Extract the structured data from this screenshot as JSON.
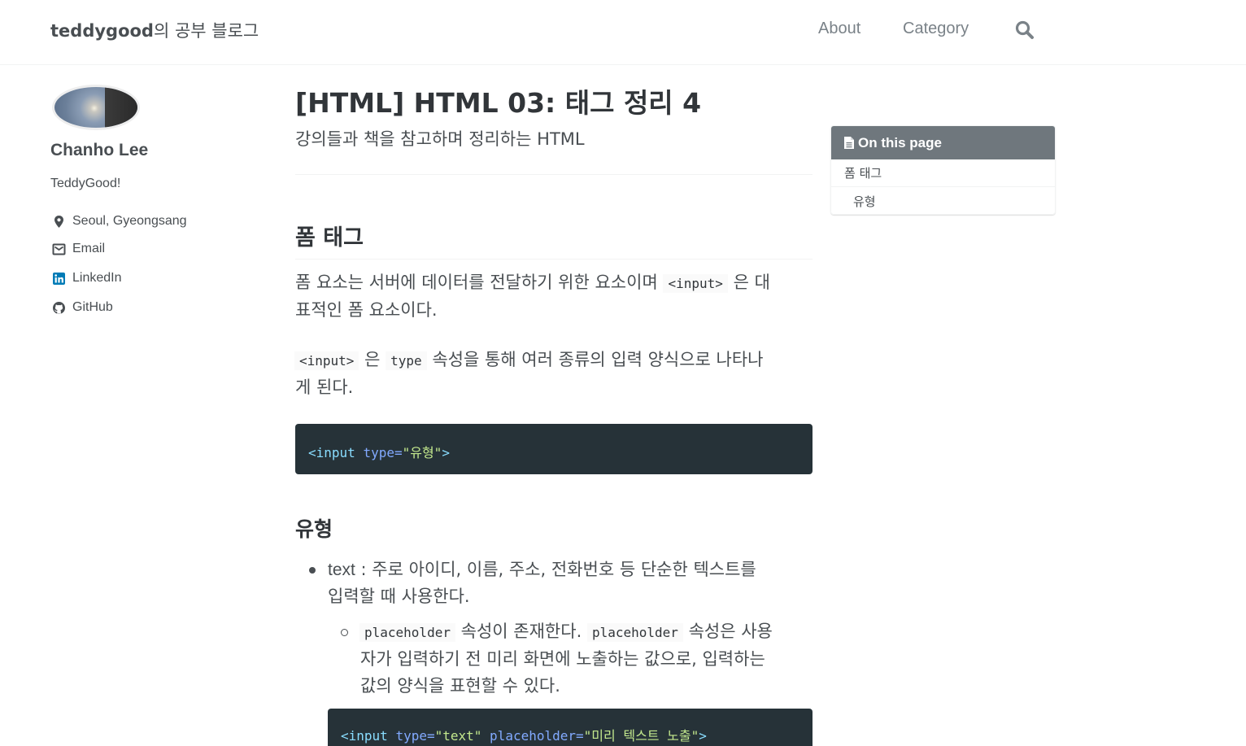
{
  "masthead": {
    "title_latin": "teddygood",
    "title_korean": "의 공부 블로그",
    "nav": [
      "About",
      "Category"
    ],
    "search_icon": "search-icon"
  },
  "author": {
    "name": "Chanho Lee",
    "bio": "TeddyGood!",
    "links": [
      {
        "icon": "map-marker-icon",
        "label": "Seoul, Gyeongsang"
      },
      {
        "icon": "envelope-icon",
        "label": "Email"
      },
      {
        "icon": "linkedin-icon",
        "label": "LinkedIn"
      },
      {
        "icon": "github-icon",
        "label": "GitHub"
      }
    ]
  },
  "post": {
    "title": "[HTML] HTML 03: 태그 정리 4",
    "excerpt": "강의들과 책을 참고하며 정리하는 HTML",
    "section_heading": "폼 태그",
    "p1_before": "폼 요소는 서버에 데이터를 전달하기 위한 요소이며",
    "p1_code": "<input>",
    "p1_after_line1": "은 대",
    "p1_line2": "표적인 폼 요소이다.",
    "p2_code1": "<input>",
    "p2_mid": "은",
    "p2_code2": "type",
    "p2_after_line1": "속성을 통해 여러 종류의 입력 양식으로 나타나",
    "p2_line2": "게 된다.",
    "code1": {
      "tag_open": "<input",
      "attr": "type",
      "eq": "=",
      "str": "\"유형\"",
      "tag_close": ">"
    },
    "subheading": "유형",
    "li1_term": "text",
    "li1_line1": " : 주로 아이디, 이름, 주소, 전화번호 등 단순한 텍스트를",
    "li1_line2": "입력할 때 사용한다.",
    "sub_code1": "placeholder",
    "sub_text1": "속성이 존재한다.",
    "sub_code2": "placeholder",
    "sub_text2": "속성은 사용",
    "sub_line2": "자가 입력하기 전 미리 화면에 노출하는 값으로, 입력하는",
    "sub_line3": "값의 양식을 표현할 수 있다.",
    "code2": {
      "tag_open": "<input",
      "attr1": "type",
      "str1": "\"text\"",
      "attr2": "placeholder",
      "str2": "\"미리 텍스트 노출\"",
      "tag_close": ">"
    }
  },
  "toc": {
    "header_icon": "file-icon",
    "header": "On this page",
    "items": [
      "폼 태그",
      "유형"
    ]
  },
  "colors": {
    "code_bg": "#263238",
    "toc_header_bg": "#6f777d",
    "link_linkedin": "#007bb6"
  }
}
